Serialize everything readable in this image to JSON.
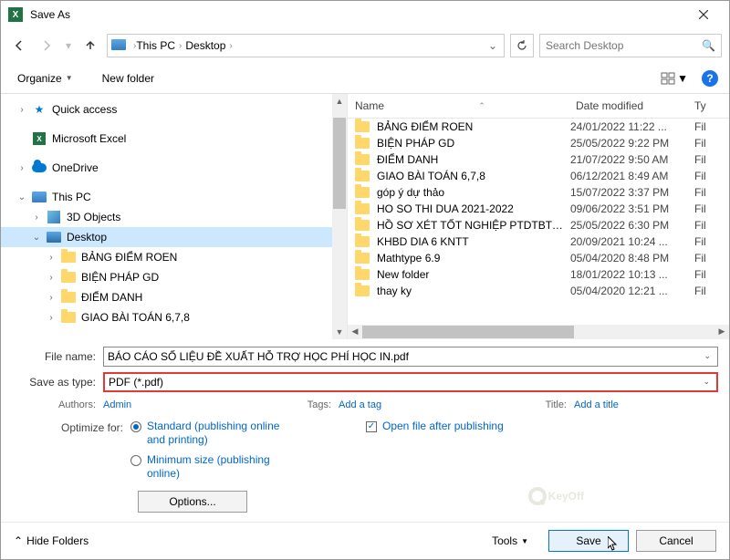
{
  "title": "Save As",
  "nav": {
    "breadcrumb": [
      "This PC",
      "Desktop"
    ],
    "search_placeholder": "Search Desktop"
  },
  "toolbar": {
    "organize": "Organize",
    "newfolder": "New folder"
  },
  "tree": {
    "quick": "Quick access",
    "excel": "Microsoft Excel",
    "onedrive": "OneDrive",
    "thispc": "This PC",
    "obj3d": "3D Objects",
    "desktop": "Desktop",
    "folders": [
      "BẢNG ĐIỂM ROEN",
      "BIỆN PHÁP GD",
      "ĐIỂM DANH",
      "GIAO BÀI TOÁN 6,7,8"
    ]
  },
  "list_header": {
    "name": "Name",
    "date": "Date modified",
    "type": "Ty"
  },
  "files": [
    {
      "name": "BẢNG ĐIỂM ROEN",
      "date": "24/01/2022 11:22 ...",
      "type": "Fil"
    },
    {
      "name": "BIỆN PHÁP GD",
      "date": "25/05/2022 9:22 PM",
      "type": "Fil"
    },
    {
      "name": "ĐIỂM DANH",
      "date": "21/07/2022 9:50 AM",
      "type": "Fil"
    },
    {
      "name": "GIAO BÀI TOÁN 6,7,8",
      "date": "06/12/2021 8:49 AM",
      "type": "Fil"
    },
    {
      "name": "góp ý dự thảo",
      "date": "15/07/2022 3:37 PM",
      "type": "Fil"
    },
    {
      "name": "HO SO THI DUA 2021-2022",
      "date": "09/06/2022 3:51 PM",
      "type": "Fil"
    },
    {
      "name": "HỒ SƠ XÉT TỐT NGHIỆP PTDTBT THCS ...",
      "date": "25/05/2022 6:30 PM",
      "type": "Fil"
    },
    {
      "name": "KHBD DIA 6 KNTT",
      "date": "20/09/2021 10:24 ...",
      "type": "Fil"
    },
    {
      "name": "Mathtype 6.9",
      "date": "05/04/2020 8:48 PM",
      "type": "Fil"
    },
    {
      "name": "New folder",
      "date": "18/01/2022 10:13 ...",
      "type": "Fil"
    },
    {
      "name": "thay ky",
      "date": "05/04/2020 12:21 ...",
      "type": "Fil"
    }
  ],
  "form": {
    "filename_label": "File name:",
    "filename": "BÁO CÁO SỐ LIỆU ĐỀ XUẤT HỖ TRỢ HỌC PHÍ HỌC IN.pdf",
    "saveastype_label": "Save as type:",
    "saveastype": "PDF (*.pdf)",
    "authors_label": "Authors:",
    "authors": "Admin",
    "tags_label": "Tags:",
    "tags": "Add a tag",
    "title_label": "Title:",
    "title_val": "Add a title",
    "optimize_label": "Optimize for:",
    "opt_standard": "Standard (publishing online and printing)",
    "opt_minimum": "Minimum size (publishing online)",
    "open_after": "Open file after publishing",
    "options_btn": "Options...",
    "tools": "Tools",
    "save": "Save",
    "cancel": "Cancel",
    "hide": "Hide Folders"
  },
  "watermark": "KeyOff"
}
